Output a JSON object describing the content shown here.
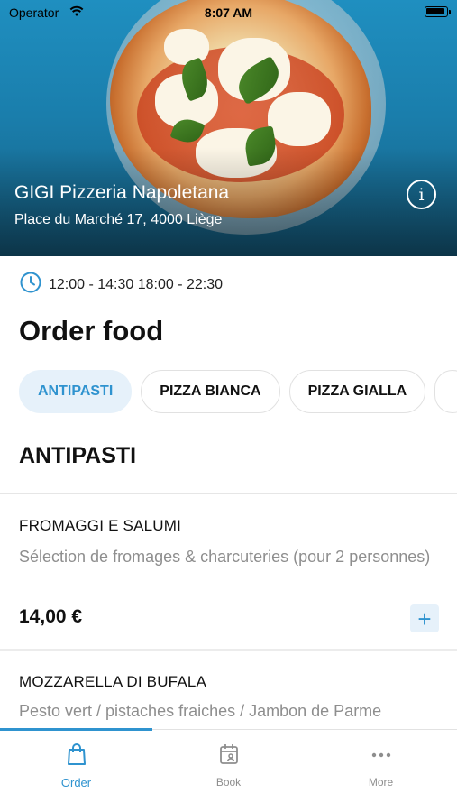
{
  "status_bar": {
    "carrier": "Operator",
    "time": "8:07 AM"
  },
  "restaurant": {
    "name": "GIGI Pizzeria Napoletana",
    "address": "Place du Marché 17, 4000 Liège"
  },
  "hours": "12:00 - 14:30  18:00 - 22:30",
  "page_title": "Order food",
  "categories": [
    {
      "label": "ANTIPASTI",
      "active": true
    },
    {
      "label": "PIZZA BIANCA",
      "active": false
    },
    {
      "label": "PIZZA GIALLA",
      "active": false
    }
  ],
  "section_title": "ANTIPASTI",
  "items": [
    {
      "name": "FROMAGGI E SALUMI",
      "description": "Sélection de fromages & charcuteries (pour 2 personnes)",
      "price": "14,00 €",
      "add_label": "+"
    },
    {
      "name": "MOZZARELLA DI BUFALA",
      "description": "Pesto vert / pistaches fraiches / Jambon de Parme"
    }
  ],
  "tabs": [
    {
      "label": "Order",
      "icon": "bag-icon",
      "active": true
    },
    {
      "label": "Book",
      "icon": "calendar-icon",
      "active": false
    },
    {
      "label": "More",
      "icon": "more-icon",
      "active": false
    }
  ],
  "colors": {
    "accent": "#2f93cf",
    "chip_active_bg": "#e6f1fa",
    "muted_text": "#8e8e8e"
  }
}
